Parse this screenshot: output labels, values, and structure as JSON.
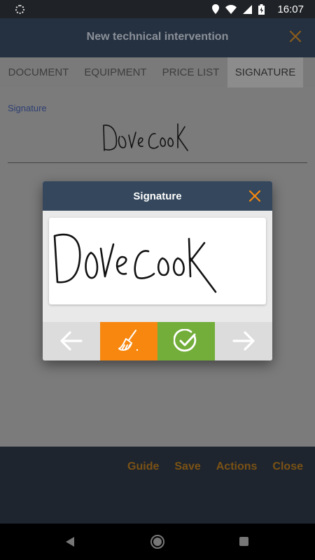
{
  "status_bar": {
    "time": "16:07",
    "icons": [
      "settings-dot-icon",
      "location-icon",
      "wifi-icon",
      "signal-icon",
      "battery-icon"
    ]
  },
  "app_header": {
    "title": "New technical intervention",
    "close_icon": "close-icon"
  },
  "tabs": [
    {
      "label": "DOCUMENT",
      "active": false
    },
    {
      "label": "EQUIPMENT",
      "active": false
    },
    {
      "label": "PRICE LIST",
      "active": false
    },
    {
      "label": "SIGNATURE",
      "active": true
    }
  ],
  "content": {
    "signature_label": "Signature"
  },
  "dialog": {
    "title": "Signature",
    "buttons": [
      {
        "icon": "arrow-left-icon",
        "color": "#dcdcdc"
      },
      {
        "icon": "broom-icon",
        "color": "#f7870f"
      },
      {
        "icon": "check-circle-icon",
        "color": "#73ad3a"
      },
      {
        "icon": "arrow-right-icon",
        "color": "#dcdcdc"
      }
    ]
  },
  "bottom_bar": {
    "links": [
      "Guide",
      "Save",
      "Actions",
      "Close"
    ]
  },
  "colors": {
    "accent_orange": "#f7870f",
    "header_navy": "#34475c",
    "confirm_green": "#73ad3a"
  }
}
